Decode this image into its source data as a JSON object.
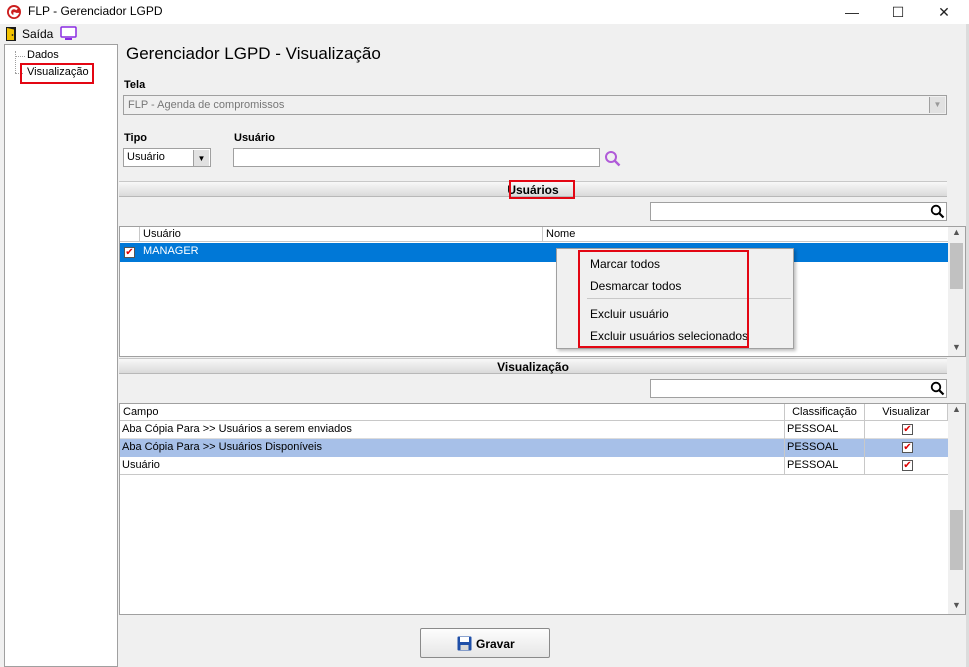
{
  "window": {
    "title": "FLP - Gerenciador LGPD",
    "minimize_glyph": "—",
    "maximize_glyph": "☐",
    "close_glyph": "✕"
  },
  "toolbar": {
    "exit_label": "Saída",
    "exit_icon": "door-exit-icon",
    "monitor_icon": "monitor-icon"
  },
  "sidebar": {
    "items": [
      {
        "label": "Dados"
      },
      {
        "label": "Visualização"
      }
    ]
  },
  "header": {
    "title": "Gerenciador LGPD - Visualização"
  },
  "form": {
    "tela_label": "Tela",
    "tela_value": "FLP - Agenda de compromissos",
    "tipo_label": "Tipo",
    "tipo_value": "Usuário",
    "usuario_label": "Usuário",
    "usuario_value": "",
    "search_icon": "search-icon"
  },
  "usuarios_section": {
    "title": "Usuários",
    "filter_value": "",
    "columns": [
      "Usuário",
      "Nome"
    ],
    "rows": [
      {
        "checked": true,
        "usuario": "MANAGER",
        "nome": ""
      }
    ]
  },
  "context_menu": {
    "items": [
      "Marcar todos",
      "Desmarcar todos",
      "Excluir usuário",
      "Excluir usuários selecionados"
    ]
  },
  "visualizacao_section": {
    "title": "Visualização",
    "filter_value": "",
    "columns": [
      "Campo",
      "Classificação",
      "Visualizar"
    ],
    "rows": [
      {
        "campo": "Aba Cópia Para >> Usuários a serem enviados",
        "classificacao": "PESSOAL",
        "visualizar": true
      },
      {
        "campo": "Aba Cópia Para >> Usuários Disponíveis",
        "classificacao": "PESSOAL",
        "visualizar": true
      },
      {
        "campo": "Usuário",
        "classificacao": "PESSOAL",
        "visualizar": true
      }
    ]
  },
  "footer": {
    "save_label": "Gravar",
    "save_icon": "floppy-disk-icon"
  },
  "colors": {
    "selection": "#0078d7",
    "row_highlight": "#a7c0e8",
    "annotation_red": "#e30613",
    "brand_red": "#cc1f1f"
  }
}
